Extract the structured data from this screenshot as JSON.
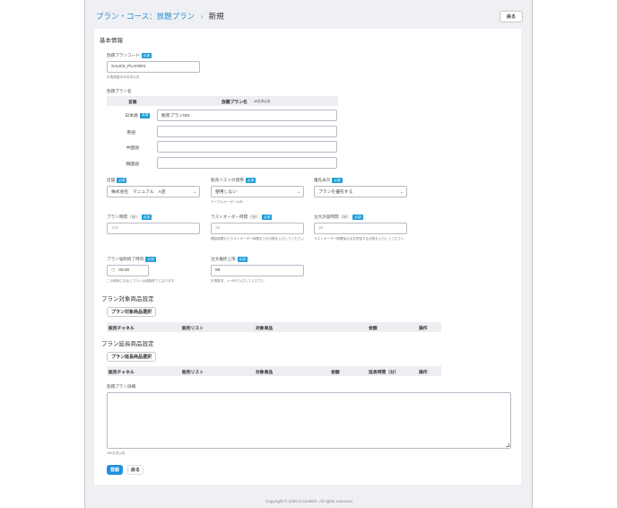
{
  "breadcrumb": {
    "parent": "プラン・コース：放題プラン",
    "separator": "›",
    "current": "新規"
  },
  "header": {
    "back_label": "戻る"
  },
  "basic": {
    "section_title": "基本情報",
    "required_badge": "必須",
    "code": {
      "label": "放題プランコード",
      "value": "SALES_PLAN001",
      "help": "半角英数字50文字以内"
    },
    "name": {
      "label": "放題プラン名",
      "col_language": "言語",
      "col_name": "放題プラン名",
      "col_name_note": "40文字以内",
      "rows": [
        {
          "lang": "日本語",
          "value": "販売プラン001",
          "required": true
        },
        {
          "lang": "英語",
          "value": "",
          "required": false
        },
        {
          "lang": "中国語",
          "value": "",
          "required": false
        },
        {
          "lang": "韓国語",
          "value": "",
          "required": false
        }
      ]
    },
    "store": {
      "label": "店舗",
      "value": "株式会社　マニュアル　A店"
    },
    "sales_list": {
      "label": "販売リストの使用",
      "value": "使用しない",
      "help": "テーブルオーダーのみ"
    },
    "priority": {
      "label": "優先表示",
      "value": "プランを優先する"
    },
    "plan_time": {
      "label": "プラン時間（分）",
      "placeholder": "120"
    },
    "last_order": {
      "label": "ラストオーダー時間（分）",
      "placeholder": "30",
      "help": "開始時間からラストオーダー時間までの分数を入力してください"
    },
    "order_allowed": {
      "label": "注文許容時間（分）",
      "placeholder": "30",
      "help": "ラストオーダー時間後の注文許容する分数を入力してください"
    },
    "forced_end": {
      "label": "プラン強制終了時刻",
      "value": "00:00",
      "help": "この時刻になるとプランは強制終了になります"
    },
    "order_limit": {
      "label": "注文推移上限",
      "value": "99",
      "help": "半角数字、1〜99で入力してください"
    }
  },
  "target_products": {
    "title": "プラン対象商品設定",
    "select_button": "プラン対象商品選択",
    "columns": [
      "販売チャネル",
      "販売リスト",
      "対象商品",
      "金額",
      "操作"
    ]
  },
  "extension_products": {
    "title": "プラン延長商品設定",
    "select_button": "プラン延長商品選択",
    "columns": [
      "販売チャネル",
      "販売リスト",
      "対象商品",
      "金額",
      "延長時間（分）",
      "操作"
    ]
  },
  "detail": {
    "label": "放題プラン詳細",
    "help": "250文字以内"
  },
  "actions": {
    "submit": "登録",
    "back": "戻る"
  },
  "footer": {
    "copyright": "Copyright © 2020 CASHIER. All rights reserved."
  }
}
